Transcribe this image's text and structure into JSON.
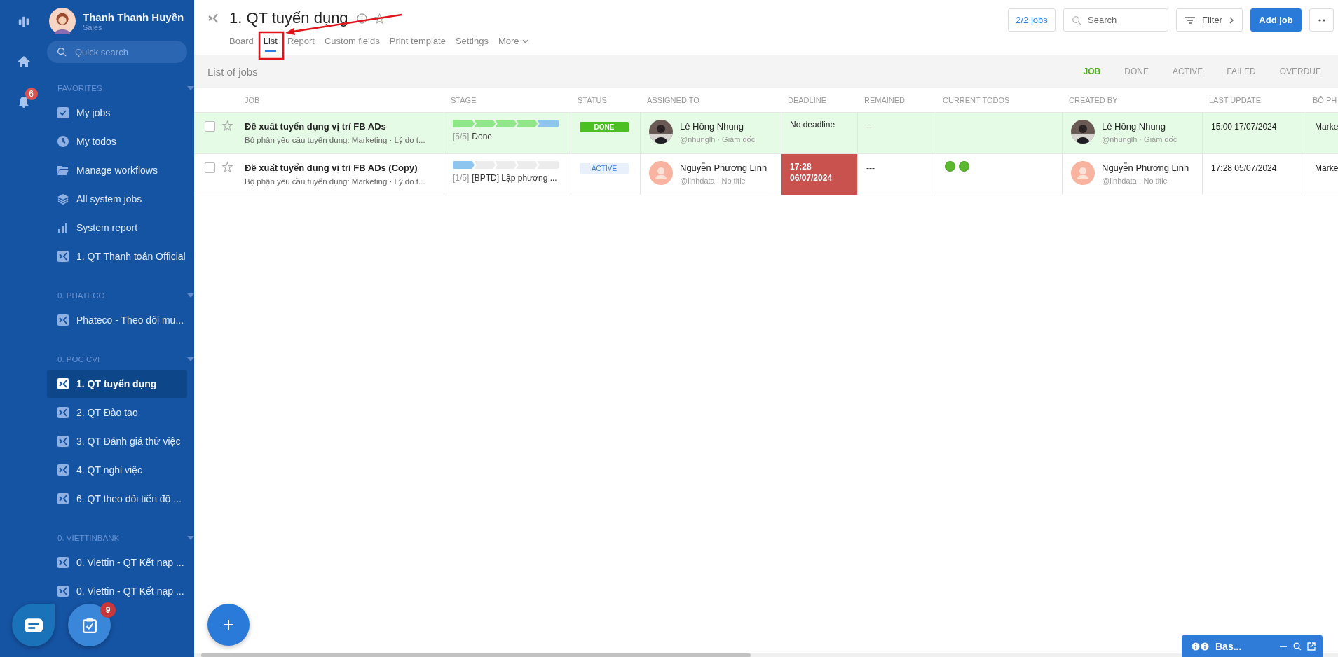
{
  "rail": {
    "notifications_badge": "6"
  },
  "profile": {
    "name": "Thanh Thanh Huyền",
    "role": "Sales"
  },
  "quick_search": {
    "placeholder": "Quick search"
  },
  "sections": [
    {
      "title": "FAVORITES",
      "items": [
        {
          "label": "My jobs",
          "kind": "check",
          "selected": false
        },
        {
          "label": "My todos",
          "kind": "clock",
          "selected": false
        },
        {
          "label": "Manage workflows",
          "kind": "folder",
          "selected": false
        },
        {
          "label": "All system jobs",
          "kind": "layers",
          "selected": false
        },
        {
          "label": "System report",
          "kind": "chart",
          "selected": false
        },
        {
          "label": "1. QT Thanh toán Official",
          "kind": "workflow",
          "selected": false
        }
      ]
    },
    {
      "title": "0. PHATECO",
      "items": [
        {
          "label": "Phateco - Theo dõi mu...",
          "kind": "workflow",
          "selected": false
        }
      ]
    },
    {
      "title": "0. POC CVI",
      "items": [
        {
          "label": "1. QT tuyển dụng",
          "kind": "workflow",
          "selected": true
        },
        {
          "label": "2. QT Đào tạo",
          "kind": "workflow",
          "selected": false
        },
        {
          "label": "3. QT Đánh giá thử việc",
          "kind": "workflow",
          "selected": false
        },
        {
          "label": "4. QT nghỉ việc",
          "kind": "workflow",
          "selected": false
        },
        {
          "label": "6. QT theo dõi tiến độ ...",
          "kind": "workflow",
          "selected": false
        }
      ]
    },
    {
      "title": "0. VIETTINBANK",
      "items": [
        {
          "label": "0. Viettin - QT Kết nạp ...",
          "kind": "workflow",
          "selected": false
        },
        {
          "label": "0. Viettin - QT Kết nạp ...",
          "kind": "workflow",
          "selected": false
        }
      ]
    }
  ],
  "floating": {
    "tasks_badge": "9"
  },
  "page": {
    "title": "1. QT tuyển dụng",
    "tabs": [
      {
        "label": "Board",
        "selected": false,
        "dropdown": false
      },
      {
        "label": "List",
        "selected": true,
        "dropdown": false
      },
      {
        "label": "Report",
        "selected": false,
        "dropdown": false
      },
      {
        "label": "Custom fields",
        "selected": false,
        "dropdown": false
      },
      {
        "label": "Print template",
        "selected": false,
        "dropdown": false
      },
      {
        "label": "Settings",
        "selected": false,
        "dropdown": false
      },
      {
        "label": "More",
        "selected": false,
        "dropdown": true
      }
    ]
  },
  "toolbar": {
    "count": "2/2 jobs",
    "search_placeholder": "Search",
    "filter": "Filter",
    "add": "Add job"
  },
  "list_title": "List of jobs",
  "filters": [
    {
      "label": "JOB",
      "selected": true
    },
    {
      "label": "DONE",
      "selected": false
    },
    {
      "label": "ACTIVE",
      "selected": false
    },
    {
      "label": "FAILED",
      "selected": false
    },
    {
      "label": "OVERDUE",
      "selected": false
    }
  ],
  "table": {
    "columns": [
      "JOB",
      "STAGE",
      "STATUS",
      "ASSIGNED TO",
      "DEADLINE",
      "REMAINED",
      "CURRENT TODOS",
      "CREATED BY",
      "LAST UPDATE",
      "BỘ PH"
    ],
    "rows": [
      {
        "title": "Đề xuất tuyển dụng vị trí FB ADs",
        "subtitle": "Bộ phận yêu cầu tuyển dụng: Marketing · Lý do t...",
        "checked": false,
        "starred": false,
        "stages": [
          {
            "done": true,
            "current": false
          },
          {
            "done": true,
            "current": false
          },
          {
            "done": true,
            "current": false
          },
          {
            "done": true,
            "current": false
          },
          {
            "done": false,
            "current": true
          }
        ],
        "stage_count": "[5/5]",
        "stage_name": "Done",
        "status": {
          "label": "DONE",
          "kind": "done"
        },
        "assignee": {
          "name": "Lê Hồng Nhung",
          "handle": "@nhunglh · Giám đốc",
          "photo": true
        },
        "deadline": {
          "text": "No deadline",
          "overdue": false
        },
        "remained": "--",
        "creator": {
          "name": "Lê Hồng Nhung",
          "handle": "@nhunglh · Giám đốc",
          "photo": true
        },
        "last_update": "15:00 17/07/2024",
        "column_10": "Marke"
      },
      {
        "title": "Đề xuất tuyển dụng vị trí FB ADs (Copy)",
        "subtitle": "Bộ phận yêu cầu tuyển dụng: Marketing · Lý do t...",
        "checked": false,
        "starred": false,
        "stages": [
          {
            "done": false,
            "current": true
          },
          {
            "done": false,
            "current": false
          },
          {
            "done": false,
            "current": false
          },
          {
            "done": false,
            "current": false
          },
          {
            "done": false,
            "current": false
          }
        ],
        "stage_count": "[1/5]",
        "stage_name": "[BPTD] Lập phương ...",
        "status": {
          "label": "ACTIVE",
          "kind": "active"
        },
        "assignee": {
          "name": "Nguyễn Phương Linh",
          "handle": "@linhdata · No title",
          "photo": false
        },
        "deadline": {
          "text": "17:28\n06/07/2024",
          "overdue": true
        },
        "remained": "---",
        "todos": [
          {
            "done": true
          },
          {
            "done": true
          }
        ],
        "creator": {
          "name": "Nguyễn Phương Linh",
          "handle": "@linhdata · No title",
          "photo": false
        },
        "last_update": "17:28 05/07/2024",
        "column_10": "Marke"
      }
    ]
  },
  "chat_widget": {
    "title": "Bas..."
  }
}
